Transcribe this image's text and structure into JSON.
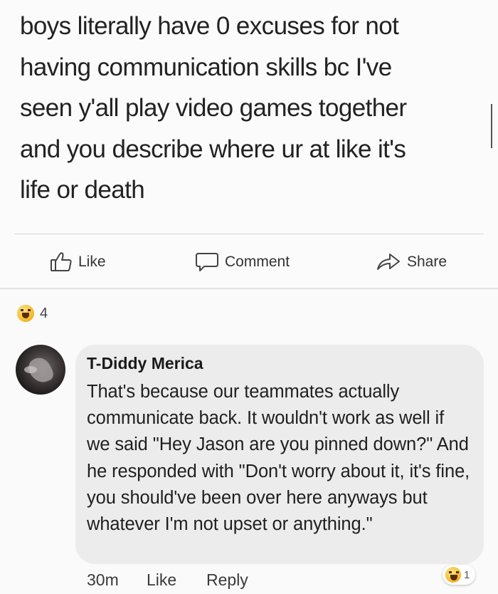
{
  "post": {
    "text_lines": [
      "boys literally have 0 excuses for not",
      "having communication skills bc I've",
      "seen y'all play video games together",
      "and you describe where ur at like it's",
      "life or death"
    ]
  },
  "actions": {
    "like_label": "Like",
    "comment_label": "Comment",
    "share_label": "Share"
  },
  "reactions": {
    "icon": "haha-emoji-icon",
    "count": "4"
  },
  "comment": {
    "author": "T-Diddy Merica",
    "text": "That's because our teammates actually communicate back. It wouldn't work as well if we said \"Hey Jason are you pinned down?\" And he responded with \"Don't worry about it, it's fine, you should've been over here anyways but whatever I'm not upset or anything.\"",
    "time": "30m",
    "like_label": "Like",
    "reply_label": "Reply",
    "reaction_count": "1",
    "reaction_icon": "haha-emoji-icon"
  }
}
